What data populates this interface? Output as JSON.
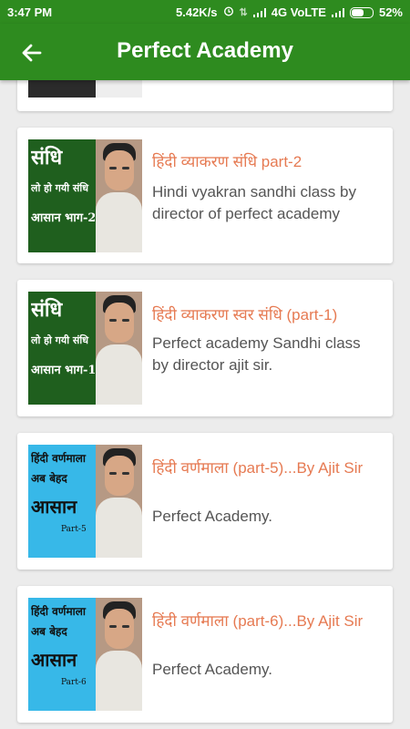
{
  "status_bar": {
    "time": "3:47 PM",
    "speed": "5.42K/s",
    "network": "4G VoLTE",
    "battery": "52%"
  },
  "app_bar": {
    "title": "Perfect Academy",
    "back_icon": "arrow-left-icon"
  },
  "videos": [
    {
      "thumb_lines": [
        "संधि",
        "लो हो गयी संधि",
        "आसान भाग-2"
      ],
      "title": "हिंदी व्याकरण संधि part-2",
      "description": "Hindi vyakran sandhi class by director of perfect academy"
    },
    {
      "thumb_lines": [
        "संधि",
        "लो हो गयी संधि",
        "आसान भाग-1"
      ],
      "title": "हिंदी व्याकरण स्वर संधि (part-1)",
      "description": "Perfect academy Sandhi class by director ajit sir."
    },
    {
      "thumb_lines": [
        "हिंदी वर्णमाला",
        "अब बेहद",
        "आसान",
        "Part-5"
      ],
      "title": "हिंदी वर्णमाला (part-5)...By Ajit Sir",
      "description": "Perfect Academy."
    },
    {
      "thumb_lines": [
        "हिंदी वर्णमाला",
        "अब बेहद",
        "आसान",
        "Part-6"
      ],
      "title": "हिंदी वर्णमाला (part-6)...By Ajit Sir",
      "description": "Perfect Academy."
    }
  ],
  "colors": {
    "app_bar": "#2e8b1f",
    "title_text": "#e67a52",
    "desc_text": "#555555",
    "background": "#ececec"
  }
}
